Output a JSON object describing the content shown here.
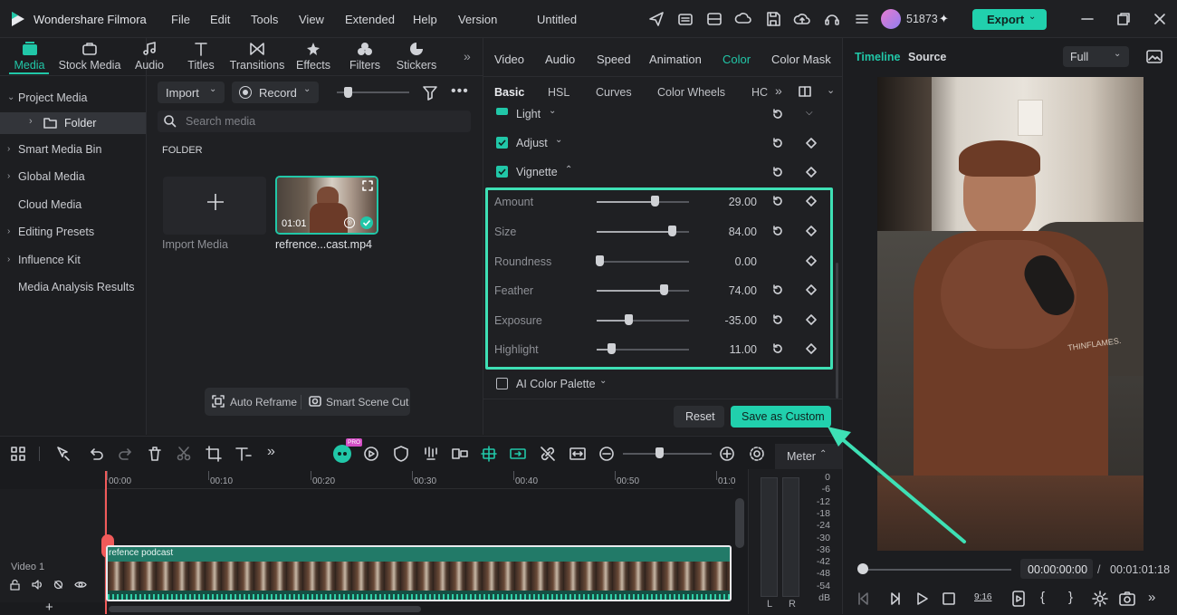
{
  "app": {
    "name": "Wondershare Filmora",
    "project": "Untitled",
    "credits": "51873",
    "export": "Export"
  },
  "menu": [
    "File",
    "Edit",
    "Tools",
    "View",
    "Extended",
    "Help",
    "Version"
  ],
  "media_tabs": [
    "Media",
    "Stock Media",
    "Audio",
    "Titles",
    "Transitions",
    "Effects",
    "Filters",
    "Stickers"
  ],
  "sidebar": [
    "Project Media",
    "Folder",
    "Smart Media Bin",
    "Global Media",
    "Cloud Media",
    "Editing Presets",
    "Influence Kit",
    "Media Analysis Results"
  ],
  "media_toolbar": {
    "import": "Import",
    "record": "Record",
    "search_placeholder": "Search media"
  },
  "folder_label": "FOLDER",
  "import_media": "Import Media",
  "clip": {
    "name": "refrence...cast.mp4",
    "duration": "01:01"
  },
  "bottom_buttons": {
    "reframe": "Auto Reframe",
    "scene": "Smart Scene Cut"
  },
  "prop_tabs": [
    "Video",
    "Audio",
    "Speed",
    "Animation",
    "Color",
    "Color Mask"
  ],
  "sub_tabs": [
    "Basic",
    "HSL",
    "Curves",
    "Color Wheels",
    "HC"
  ],
  "sections": {
    "light": "Light",
    "adjust": "Adjust",
    "vignette": "Vignette",
    "ai_palette": "AI Color Palette"
  },
  "vignette": [
    {
      "label": "Amount",
      "value": "29.00",
      "level": 0.62
    },
    {
      "label": "Size",
      "value": "84.00",
      "level": 0.82
    },
    {
      "label": "Roundness",
      "value": "0.00",
      "level": 0.0
    },
    {
      "label": "Feather",
      "value": "74.00",
      "level": 0.72
    },
    {
      "label": "Exposure",
      "value": "-35.00",
      "level": 0.33
    },
    {
      "label": "Highlight",
      "value": "11.00",
      "level": 0.13
    }
  ],
  "prop_buttons": {
    "reset": "Reset",
    "save": "Save as Custom"
  },
  "preview": {
    "timeline": "Timeline",
    "source": "Source",
    "zoom": "Full",
    "time_current": "00:00:00:00",
    "time_sep": "/",
    "time_total": "00:01:01:18",
    "aspect": "9:16"
  },
  "timeline": {
    "meter": "Meter",
    "track": "Video 1",
    "clip_title": "refence podcast",
    "ticks": [
      "00:00",
      "00:10",
      "00:20",
      "00:30",
      "00:40",
      "00:50",
      "01:0"
    ],
    "meter_scale": [
      "0",
      "-6",
      "-12",
      "-18",
      "-24",
      "-30",
      "-36",
      "-42",
      "-48",
      "-54",
      "dB"
    ],
    "lr": [
      "L",
      "R"
    ],
    "pro_badge": "PRO"
  },
  "colors": {
    "accent": "#21c7a8",
    "highlight_box": "#3ee0b5",
    "bg": "#1f2023"
  }
}
